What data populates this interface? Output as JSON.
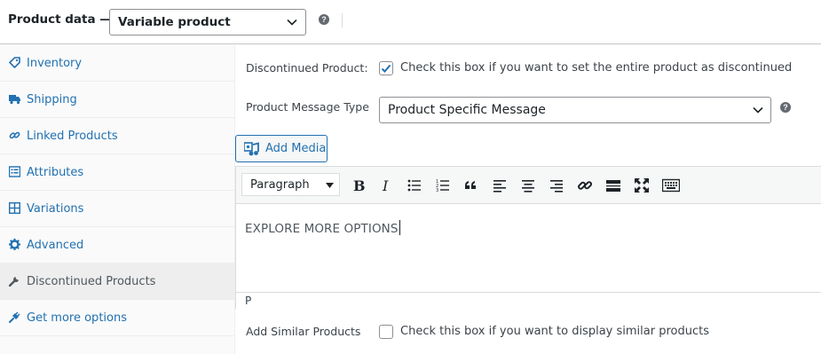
{
  "header": {
    "title": "Product data —",
    "product_type": "Variable product"
  },
  "sidebar": {
    "items": [
      {
        "label": "Inventory",
        "icon": "tag-icon"
      },
      {
        "label": "Shipping",
        "icon": "truck-icon"
      },
      {
        "label": "Linked Products",
        "icon": "link-icon"
      },
      {
        "label": "Attributes",
        "icon": "list-icon"
      },
      {
        "label": "Variations",
        "icon": "grid-icon"
      },
      {
        "label": "Advanced",
        "icon": "gear-icon"
      },
      {
        "label": "Discontinued Products",
        "icon": "wrench-icon",
        "active": true
      },
      {
        "label": "Get more options",
        "icon": "plugin-icon"
      }
    ]
  },
  "main": {
    "discontinued": {
      "label": "Discontinued Product:",
      "checked": true,
      "text": "Check this box if you want to set the entire product as discontinued"
    },
    "message_type": {
      "label": "Product Message Type",
      "value": "Product Specific Message"
    },
    "add_media_label": "Add Media",
    "editor": {
      "format": "Paragraph",
      "content": "EXPLORE MORE OPTIONS",
      "path": "P"
    },
    "similar": {
      "label": "Add Similar Products",
      "checked": false,
      "text": "Check this box if you want to display similar products"
    }
  },
  "colors": {
    "accent": "#2271b1",
    "text": "#1d2327",
    "border": "#8c8f94"
  }
}
